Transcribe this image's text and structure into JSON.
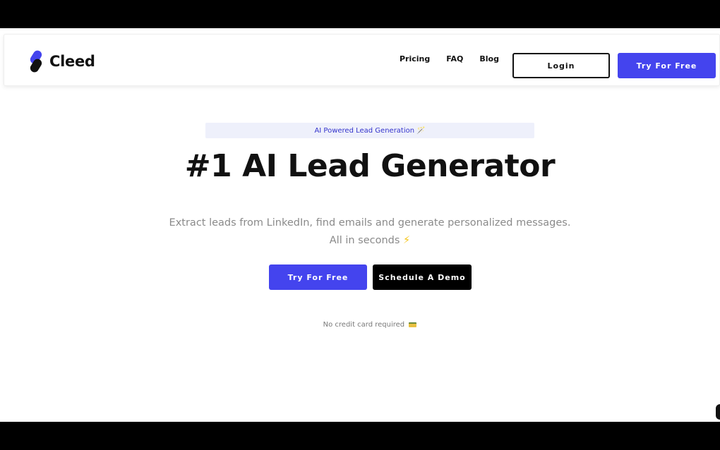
{
  "brand": {
    "name": "Cleed",
    "accent": "#4444ee"
  },
  "nav": {
    "links": [
      "Pricing",
      "FAQ",
      "Blog"
    ],
    "login_label": "Login",
    "try_label": "Try For Free"
  },
  "hero": {
    "badge_text": "AI Powered Lead Generation",
    "badge_icon": "magic-wand-icon",
    "title": "#1 AI Lead Generator",
    "subtitle_line1": "Extract leads from LinkedIn, find emails and generate personalized messages.",
    "subtitle_line2": "All in seconds",
    "subtitle_icon": "lightning-icon",
    "primary_cta": "Try For Free",
    "secondary_cta": "Schedule A Demo",
    "note": "No credit card required",
    "note_icon": "credit-card-icon"
  },
  "colors": {
    "primary": "#4444ee",
    "dark": "#000000",
    "badge_bg": "#eef0fb"
  }
}
